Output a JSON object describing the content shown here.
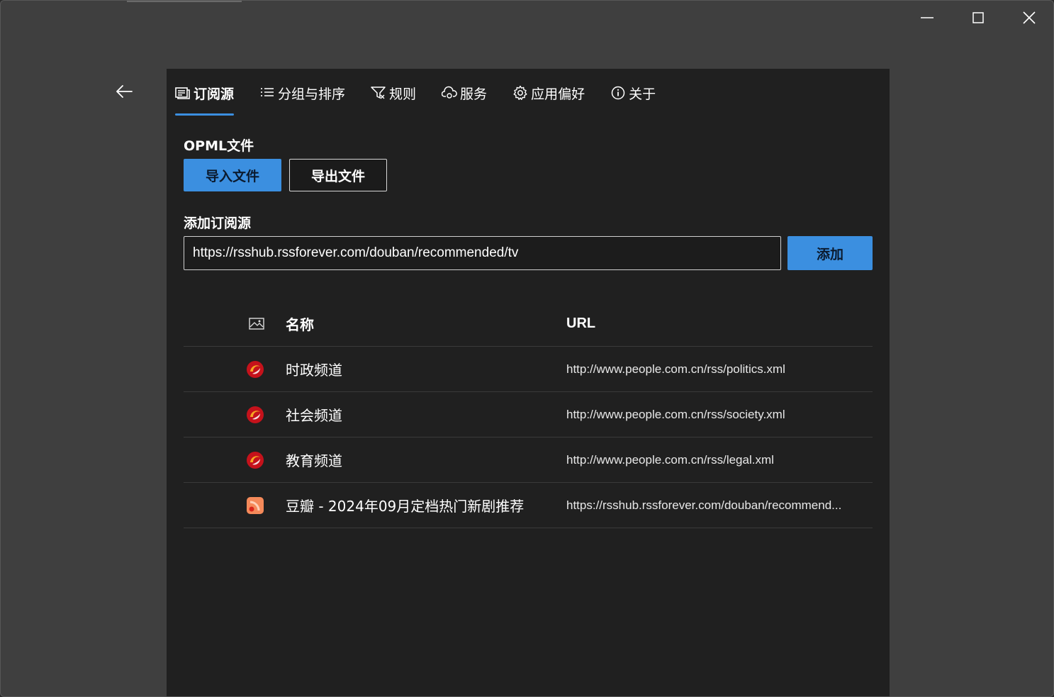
{
  "window": {
    "controls": {
      "minimize_icon": "minimize-icon",
      "maximize_icon": "maximize-icon",
      "close_icon": "close-icon"
    }
  },
  "nav": {
    "back_icon": "back-arrow-icon"
  },
  "tabs": [
    {
      "label": "订阅源",
      "icon": "feed-list-icon",
      "active": true
    },
    {
      "label": "分组与排序",
      "icon": "list-icon",
      "active": false
    },
    {
      "label": "规则",
      "icon": "filter-icon",
      "active": false
    },
    {
      "label": "服务",
      "icon": "cloud-sync-icon",
      "active": false
    },
    {
      "label": "应用偏好",
      "icon": "gear-icon",
      "active": false
    },
    {
      "label": "关于",
      "icon": "info-icon",
      "active": false
    }
  ],
  "opml": {
    "title": "OPML文件",
    "import_label": "导入文件",
    "export_label": "导出文件"
  },
  "add_feed": {
    "title": "添加订阅源",
    "input_value": "https://rsshub.rssforever.com/douban/recommended/tv",
    "add_label": "添加"
  },
  "table": {
    "header_icon": "image-icon",
    "col_name": "名称",
    "col_url": "URL",
    "rows": [
      {
        "name": "时政频道",
        "url": "http://www.people.com.cn/rss/politics.xml",
        "icon": "people-logo-icon"
      },
      {
        "name": "社会频道",
        "url": "http://www.people.com.cn/rss/society.xml",
        "icon": "people-logo-icon"
      },
      {
        "name": "教育频道",
        "url": "http://www.people.com.cn/rss/legal.xml",
        "icon": "people-logo-icon"
      },
      {
        "name": "豆瓣 - 2024年09月定档热门新剧推荐",
        "url": "https://rsshub.rssforever.com/douban/recommend...",
        "icon": "rss-icon"
      }
    ]
  },
  "colors": {
    "accent": "#3b8fe0",
    "panel_bg": "#202020",
    "window_bg": "#3f3f3f"
  }
}
